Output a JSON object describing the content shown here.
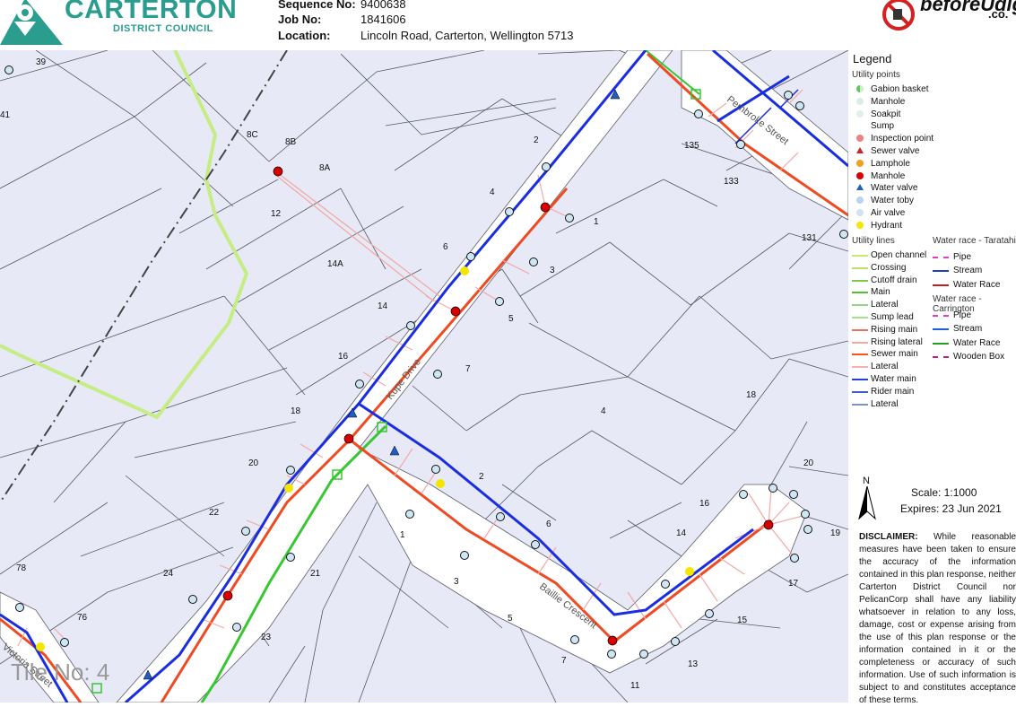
{
  "header": {
    "council_name": "CARTERTON",
    "council_sub": "DISTRICT COUNCIL",
    "sequence_label": "Sequence No:",
    "sequence_value": "9400638",
    "job_label": "Job No:",
    "job_value": "1841606",
    "location_label": "Location:",
    "location_value": "Lincoln Road, Carterton, Wellington  5713",
    "bud_brand": "beforeUdig",
    "bud_domain": ".co."
  },
  "map": {
    "tile_label": "Tile No: 4",
    "street_labels": [
      "Kupe Drive",
      "Baillie Crescent",
      "Pembroke Street",
      "Victoria Street"
    ],
    "lot_numbers": [
      "39",
      "41",
      "8C",
      "8B",
      "8A",
      "12",
      "14A",
      "14",
      "16",
      "18",
      "20",
      "22",
      "24",
      "21",
      "23",
      "78",
      "76",
      "6",
      "4",
      "2",
      "1",
      "3",
      "5",
      "7",
      "4",
      "2",
      "6",
      "1",
      "3",
      "5",
      "7",
      "11",
      "13",
      "15",
      "17",
      "19",
      "20",
      "16",
      "14",
      "18",
      "135",
      "133",
      "131"
    ]
  },
  "legend": {
    "title": "Legend",
    "points_heading": "Utility points",
    "points": [
      {
        "label": "Gabion basket",
        "color": "#5ac85a",
        "shape": "half-circle"
      },
      {
        "label": "Manhole",
        "color": "#d8efe0",
        "shape": "circle"
      },
      {
        "label": "Soakpit",
        "color": "#e1efe4",
        "shape": "circle"
      },
      {
        "label": "Sump",
        "color": "",
        "shape": "none"
      },
      {
        "label": "Inspection point",
        "color": "#f08080",
        "shape": "circle"
      },
      {
        "label": "Sewer valve",
        "color": "#d62020",
        "shape": "triangle"
      },
      {
        "label": "Lamphole",
        "color": "#f0a020",
        "shape": "circle"
      },
      {
        "label": "Manhole",
        "color": "#d80000",
        "shape": "circle"
      },
      {
        "label": "Water valve",
        "color": "#1f5fbf",
        "shape": "triangle"
      },
      {
        "label": "Water toby",
        "color": "#b9d4ee",
        "shape": "circle"
      },
      {
        "label": "Air valve",
        "color": "#cfe3f5",
        "shape": "circle"
      },
      {
        "label": "Hydrant",
        "color": "#f5e600",
        "shape": "circle"
      }
    ],
    "lines_heading": "Utility lines",
    "lines": [
      {
        "label": "Open channel",
        "color": "#c8e87a"
      },
      {
        "label": "Crossing",
        "color": "#b8e070"
      },
      {
        "label": "Cutoff drain",
        "color": "#7cc850"
      },
      {
        "label": "Main",
        "color": "#50c030"
      },
      {
        "label": "Lateral",
        "color": "#90d880"
      },
      {
        "label": "Sump lead",
        "color": "#a8e090"
      },
      {
        "label": "Rising main",
        "color": "#f07060"
      },
      {
        "label": "Rising lateral",
        "color": "#f4a8a0"
      },
      {
        "label": "Sewer main",
        "color": "#ff5020"
      },
      {
        "label": "Lateral",
        "color": "#f8b0b0"
      },
      {
        "label": "Water main",
        "color": "#2040e0"
      },
      {
        "label": "Rider main",
        "color": "#4060c0"
      },
      {
        "label": "Lateral",
        "color": "#8090c8"
      }
    ],
    "race_tara_heading": "Water race - Taratahi",
    "race_tara": [
      {
        "label": "Pipe",
        "color": "#e040c0",
        "style": "dashed"
      },
      {
        "label": "Stream",
        "color": "#2040c0",
        "style": "solid"
      },
      {
        "label": "Water Race",
        "color": "#c02020",
        "style": "solid"
      }
    ],
    "race_carr_heading": "Water race - Carrington",
    "race_carr": [
      {
        "label": "Pipe",
        "color": "#e040c0",
        "style": "dashed"
      },
      {
        "label": "Stream",
        "color": "#2060e0",
        "style": "solid"
      },
      {
        "label": "Water Race",
        "color": "#20a020",
        "style": "solid"
      },
      {
        "label": "Wooden Box",
        "color": "#c02080",
        "style": "dashed"
      }
    ]
  },
  "scale_block": {
    "north": "N",
    "scale": "Scale:   1:1000",
    "expires": "Expires:   23 Jun 2021"
  },
  "disclaimer": {
    "heading": "DISCLAIMER:",
    "text": "While reasonable measures have been taken to ensure the accuracy of the information contained in this plan response, neither Carterton District Council nor PelicanCorp shall have any liability whatsoever in relation to any loss, damage, cost or expense arising from the use of this plan response or the information contained in it or the completeness or accuracy of such information. Use of such information is subject to and constitutes acceptance of these terms."
  }
}
